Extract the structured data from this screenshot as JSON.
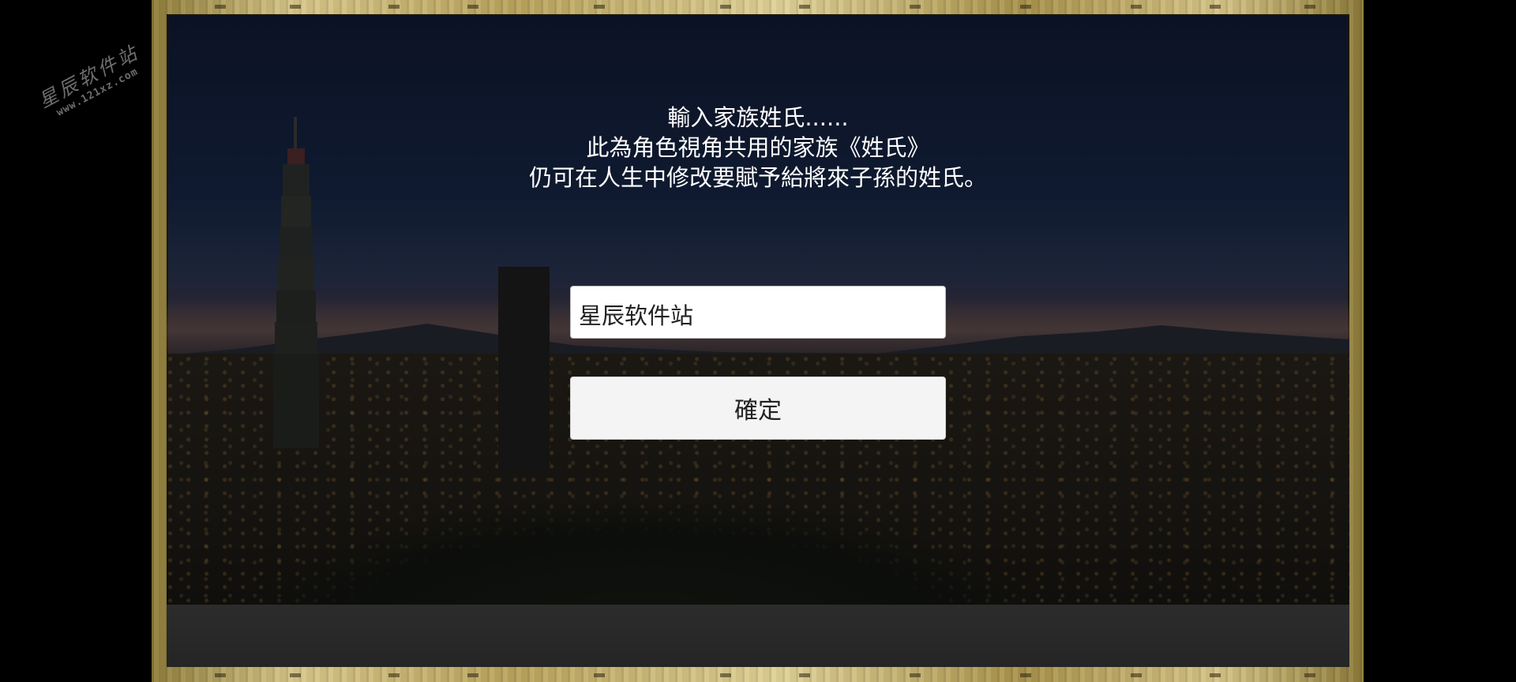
{
  "prompt": {
    "line1": "輸入家族姓氏......",
    "line2": "此為角色視角共用的家族《姓氏》",
    "line3": "仍可在人生中修改要賦予給將來子孫的姓氏。"
  },
  "surname_input": {
    "value": "星辰软件站"
  },
  "confirm_button": {
    "label": "確定"
  },
  "watermark": {
    "name": "星辰软件站",
    "url": "www.121xz.com"
  },
  "colors": {
    "frame_gold": "#d8c789",
    "prompt_text": "#ffffff",
    "button_bg": "#f4f4f4"
  }
}
